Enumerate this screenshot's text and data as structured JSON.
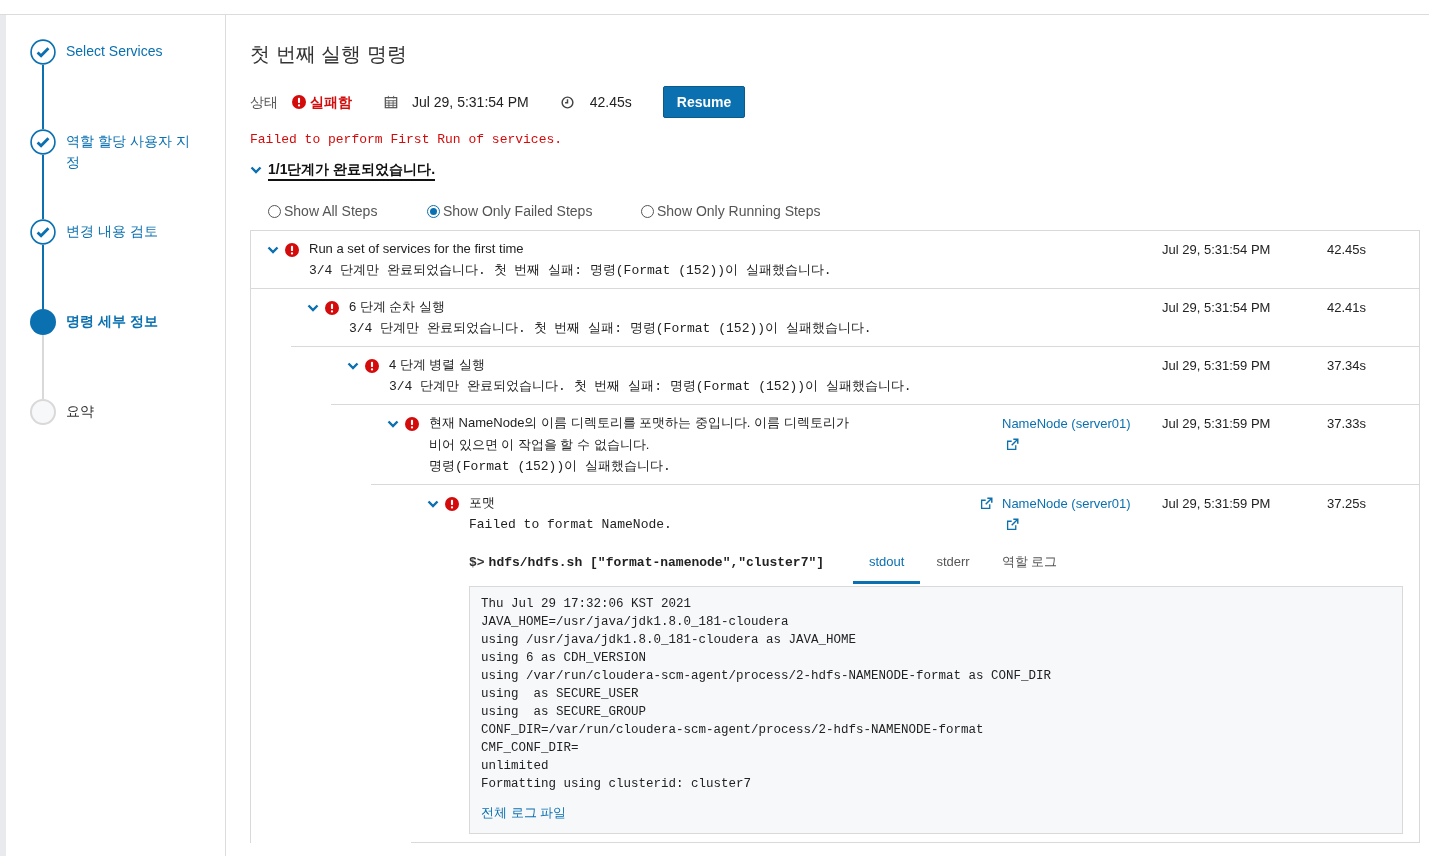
{
  "wizard_steps": [
    {
      "label": "Select Services",
      "completed": true,
      "current": false
    },
    {
      "label": "역할 할당 사용자 지정",
      "completed": true,
      "current": false
    },
    {
      "label": "변경 내용 검토",
      "completed": true,
      "current": false
    },
    {
      "label": "명령 세부 정보",
      "completed": false,
      "current": true
    },
    {
      "label": "요약",
      "completed": false,
      "current": false
    }
  ],
  "title": "첫 번째 실행 명령",
  "status": {
    "label": "상태",
    "value": "실패함",
    "failed": true,
    "started": "Jul 29, 5:31:54 PM",
    "duration": "42.45s"
  },
  "resume_button": "Resume",
  "error_message": "Failed to perform First Run of services.",
  "summary": {
    "text": "1/1단계가 완료되었습니다.",
    "expanded": true
  },
  "filters": [
    {
      "label": "Show All Steps",
      "selected": false
    },
    {
      "label": "Show Only Failed Steps",
      "selected": true
    },
    {
      "label": "Show Only Running Steps",
      "selected": false
    }
  ],
  "steps": [
    {
      "title": "Run a set of services for the first time",
      "message": "3/4 단계만 완료되었습니다. 첫 번째 실패: 명령(Format (152))이 실패했습니다.",
      "time": "Jul 29, 5:31:54 PM",
      "duration": "42.45s",
      "failed": true,
      "expanded": true,
      "children": [
        {
          "title": "6 단계 순차 실행",
          "message": "3/4 단계만 완료되었습니다. 첫 번째 실패: 명령(Format (152))이 실패했습니다.",
          "time": "Jul 29, 5:31:54 PM",
          "duration": "42.41s",
          "failed": true,
          "expanded": true,
          "children": [
            {
              "title": "4 단계 병렬 실행",
              "message": "3/4 단계만 완료되었습니다. 첫 번째 실패: 명령(Format (152))이 실패했습니다.",
              "time": "Jul 29, 5:31:59 PM",
              "duration": "37.34s",
              "failed": true,
              "expanded": true,
              "children": [
                {
                  "title": "현재 NameNode의 이름 디렉토리를 포맷하는 중입니다. 이름 디렉토리가 비어 있으면 이 작업을 할 수 없습니다.",
                  "message": "명령(Format (152))이 실패했습니다.",
                  "host": "NameNode (server01)",
                  "time": "Jul 29, 5:31:59 PM",
                  "duration": "37.33s",
                  "failed": true,
                  "expanded": true,
                  "children": [
                    {
                      "title": "포맷",
                      "message": "Failed to format NameNode.",
                      "host": "NameNode (server01)",
                      "time": "Jul 29, 5:31:59 PM",
                      "duration": "37.25s",
                      "failed": true,
                      "expanded": true,
                      "log": {
                        "prompt": "$>",
                        "command": "hdfs/hdfs.sh [\"format-namenode\",\"cluster7\"]",
                        "tabs": [
                          {
                            "label": "stdout",
                            "selected": true
                          },
                          {
                            "label": "stderr",
                            "selected": false
                          },
                          {
                            "label": "역할 로그",
                            "selected": false
                          }
                        ],
                        "lines": [
                          "Thu Jul 29 17:32:06 KST 2021",
                          "JAVA_HOME=/usr/java/jdk1.8.0_181-cloudera",
                          "using /usr/java/jdk1.8.0_181-cloudera as JAVA_HOME",
                          "using 6 as CDH_VERSION",
                          "using /var/run/cloudera-scm-agent/process/2-hdfs-NAMENODE-format as CONF_DIR",
                          "using  as SECURE_USER",
                          "using  as SECURE_GROUP",
                          "CONF_DIR=/var/run/cloudera-scm-agent/process/2-hdfs-NAMENODE-format",
                          "CMF_CONF_DIR=",
                          "unlimited",
                          "Formatting using clusterid: cluster7"
                        ],
                        "full_log_link": "전체 로그 파일"
                      }
                    }
                  ]
                }
              ]
            }
          ]
        }
      ]
    }
  ]
}
